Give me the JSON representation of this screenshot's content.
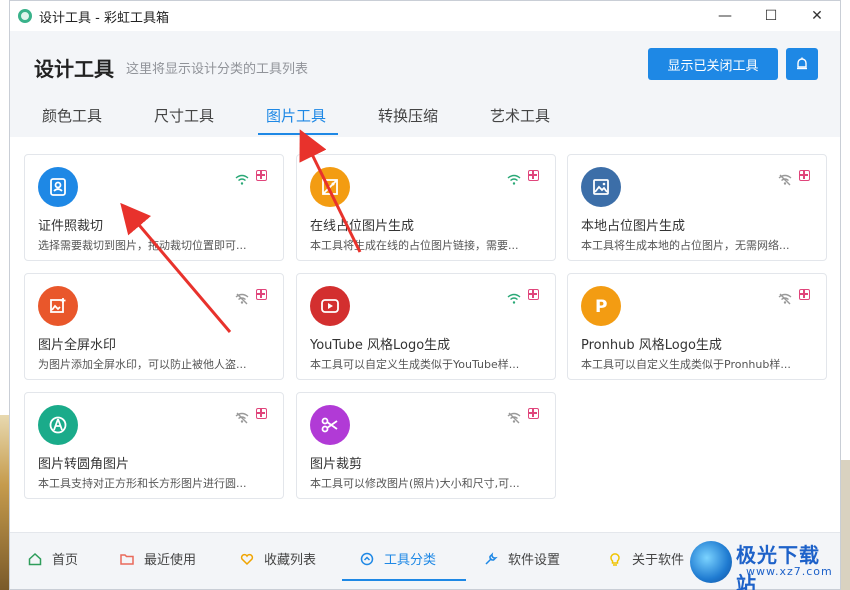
{
  "window": {
    "title": "设计工具 - 彩虹工具箱",
    "controls": {
      "minimize": "—",
      "maximize": "☐",
      "close": "✕"
    }
  },
  "header": {
    "title": "设计工具",
    "subtitle": "这里将显示设计分类的工具列表",
    "show_closed_button": "显示已关闭工具",
    "icon_button": "bell-icon"
  },
  "tabs": [
    {
      "label": "颜色工具",
      "active": false
    },
    {
      "label": "尺寸工具",
      "active": false
    },
    {
      "label": "图片工具",
      "active": true
    },
    {
      "label": "转换压缩",
      "active": false
    },
    {
      "label": "艺术工具",
      "active": false
    }
  ],
  "cards": [
    {
      "name": "证件照裁切",
      "desc": "选择需要裁切到图片，拖动裁切位置即可...",
      "icon": "id-photo-icon",
      "color": "#1e88e5",
      "online": true
    },
    {
      "name": "在线占位图片生成",
      "desc": "本工具将生成在线的占位图片链接，需要...",
      "icon": "placeholder-image-icon",
      "color": "#f39c12",
      "online": true
    },
    {
      "name": "本地占位图片生成",
      "desc": "本工具将生成本地的占位图片，无需网络...",
      "icon": "image-icon",
      "color": "#3c6ea8",
      "online": false
    },
    {
      "name": "图片全屏水印",
      "desc": "为图片添加全屏水印，可以防止被他人盗...",
      "icon": "add-image-icon",
      "color": "#e9572b",
      "online": false
    },
    {
      "name": "YouTube 风格Logo生成",
      "desc": "本工具可以自定义生成类似于YouTube样...",
      "icon": "play-icon",
      "color": "#d32f2f",
      "online": true
    },
    {
      "name": "Pronhub 风格Logo生成",
      "desc": "本工具可以自定义生成类似于Pronhub样...",
      "icon": "letter-p-icon",
      "color": "#f39c12",
      "online": false
    },
    {
      "name": "图片转圆角图片",
      "desc": "本工具支持对正方形和长方形图片进行圆...",
      "icon": "compass-icon",
      "color": "#1aab8a",
      "online": false
    },
    {
      "name": "图片裁剪",
      "desc": "本工具可以修改图片(照片)大小和尺寸,可...",
      "icon": "scissors-icon",
      "color": "#b13ad6",
      "online": false
    }
  ],
  "bottom_nav": [
    {
      "label": "首页",
      "icon": "home-icon",
      "active": false,
      "color": "#2e9d5b"
    },
    {
      "label": "最近使用",
      "icon": "folder-icon",
      "active": false,
      "color": "#e96a5a"
    },
    {
      "label": "收藏列表",
      "icon": "heart-icon",
      "active": false,
      "color": "#f0a400"
    },
    {
      "label": "工具分类",
      "icon": "category-icon",
      "active": true,
      "color": "#1e88e5"
    },
    {
      "label": "软件设置",
      "icon": "wrench-icon",
      "active": false,
      "color": "#1e88e5"
    },
    {
      "label": "关于软件",
      "icon": "bulb-icon",
      "active": false,
      "color": "#f0c400"
    }
  ],
  "watermark": {
    "text": "极光下载站",
    "url": "www.xz7.com"
  },
  "colors": {
    "accent": "#1e88e5",
    "arrow": "#e8322c",
    "fav": "#e0457b",
    "online": "#2aa876",
    "offline": "#999999"
  }
}
